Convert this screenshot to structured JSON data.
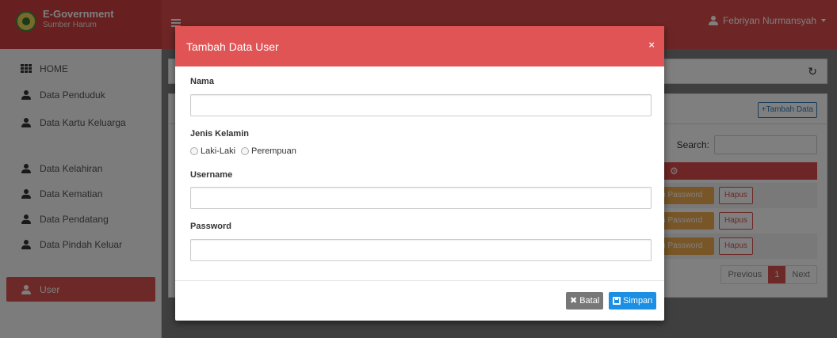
{
  "brand": {
    "title": "E-Government",
    "subtitle": "Sumber Harum"
  },
  "header": {
    "user_name": "Febriyan Nurmansyah"
  },
  "sidebar": {
    "items": [
      {
        "label": "HOME",
        "icon": "grid-icon"
      },
      {
        "label": "Data Penduduk",
        "icon": "user-icon"
      },
      {
        "label": "Data Kartu Keluarga",
        "icon": "users-icon"
      },
      {
        "label": "Data Kelahiran",
        "icon": "child-icon"
      },
      {
        "label": "Data Kematian",
        "icon": "user-times-icon"
      },
      {
        "label": "Data Pendatang",
        "icon": "user-plus-icon"
      },
      {
        "label": "Data Pindah Keluar",
        "icon": "user-minus-icon"
      },
      {
        "label": "User",
        "icon": "users-cog-icon",
        "active": true
      }
    ]
  },
  "content": {
    "add_button": "Tambah Data",
    "search_label": "Search:",
    "rows": [
      {
        "password_button": "bah Password",
        "delete_button": "Hapus"
      },
      {
        "password_button": "bah Password",
        "delete_button": "Hapus"
      },
      {
        "password_button": "bah Password",
        "delete_button": "Hapus"
      }
    ],
    "pagination": {
      "previous": "Previous",
      "current": "1",
      "next": "Next"
    }
  },
  "modal": {
    "title": "Tambah Data User",
    "close": "×",
    "fields": {
      "nama": {
        "label": "Nama",
        "value": ""
      },
      "jenis_kelamin": {
        "label": "Jenis Kelamin",
        "options": [
          "Laki-Laki",
          "Perempuan"
        ]
      },
      "username": {
        "label": "Username",
        "value": ""
      },
      "password": {
        "label": "Password",
        "value": ""
      }
    },
    "buttons": {
      "cancel": "Batal",
      "save": "Simpan"
    }
  },
  "colors": {
    "primary_red": "#dd4b4b",
    "modal_header": "#e05455",
    "save_blue": "#1a8fe3",
    "cancel_gray": "#777777",
    "warning": "#f0ad4e"
  }
}
